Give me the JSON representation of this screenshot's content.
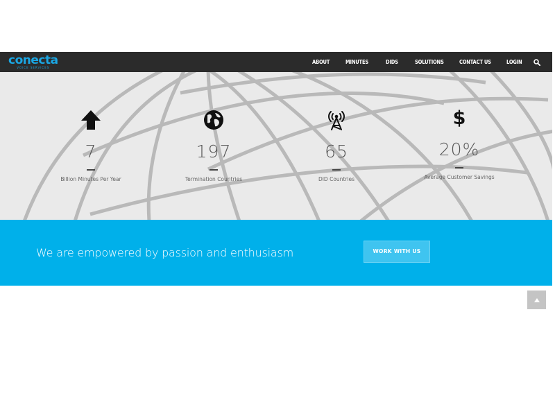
{
  "brand": {
    "logo_text": "conecta",
    "logo_subtext": "VOICE SERVICES"
  },
  "nav": {
    "items": [
      {
        "label": "ABOUT"
      },
      {
        "label": "MINUTES"
      },
      {
        "label": "DIDS"
      },
      {
        "label": "SOLUTIONS"
      },
      {
        "label": "CONTACT US"
      },
      {
        "label": "LOGIN"
      }
    ],
    "search_icon": "search-icon"
  },
  "stats": [
    {
      "icon": "arrow-up-icon",
      "value": "7",
      "label": "Billion Minutes Per Year"
    },
    {
      "icon": "globe-icon",
      "value": "197",
      "label": "Termination Countries"
    },
    {
      "icon": "antenna-icon",
      "value": "65",
      "label": "DID Countries"
    },
    {
      "icon": "dollar-icon",
      "value": "20%",
      "label": "Average Customer Savings"
    }
  ],
  "cta": {
    "text": "We are empowered by passion and enthusiasm",
    "button_label": "WORK WITH US"
  },
  "back_to_top_icon": "chevron-up-icon",
  "colors": {
    "navbar": "#2b2b2b",
    "brand": "#1aa7e4",
    "cta_band": "#00b0ea",
    "stats_bg": "#eaeaea"
  }
}
